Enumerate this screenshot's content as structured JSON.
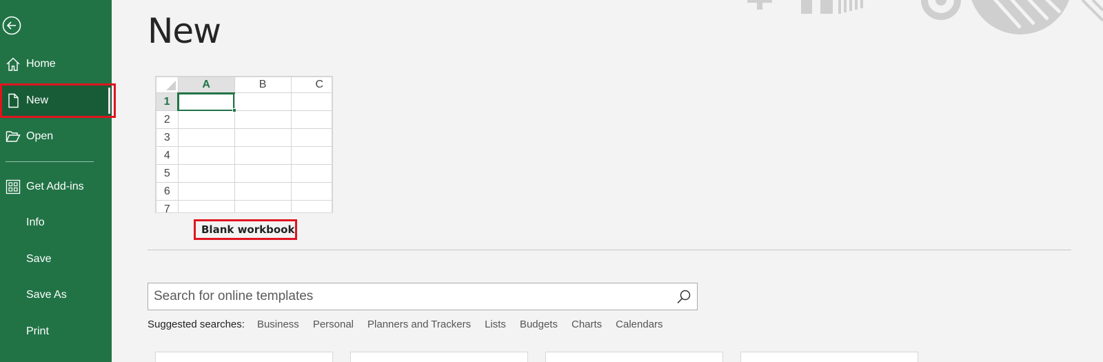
{
  "sidebar": {
    "back_icon": "back-arrow-icon",
    "items": [
      {
        "label": "Home",
        "icon": "home-icon"
      },
      {
        "label": "New",
        "icon": "new-document-icon",
        "active": true
      },
      {
        "label": "Open",
        "icon": "folder-open-icon"
      },
      {
        "label": "Get Add-ins",
        "icon": "add-ins-grid-icon"
      },
      {
        "label": "Info"
      },
      {
        "label": "Save"
      },
      {
        "label": "Save As"
      },
      {
        "label": "Print"
      }
    ],
    "colors": {
      "background": "#217346",
      "active": "#185c37",
      "highlight": "#e0141e"
    }
  },
  "main": {
    "title": "New",
    "blank_workbook": {
      "label": "Blank workbook",
      "columns": [
        "A",
        "B",
        "C"
      ],
      "rows": [
        "1",
        "2",
        "3",
        "4",
        "5",
        "6",
        "7"
      ]
    },
    "search": {
      "placeholder": "Search for online templates",
      "icon": "search-icon"
    },
    "suggested": {
      "label": "Suggested searches:",
      "items": [
        "Business",
        "Personal",
        "Planners and Trackers",
        "Lists",
        "Budgets",
        "Charts",
        "Calendars"
      ]
    }
  }
}
